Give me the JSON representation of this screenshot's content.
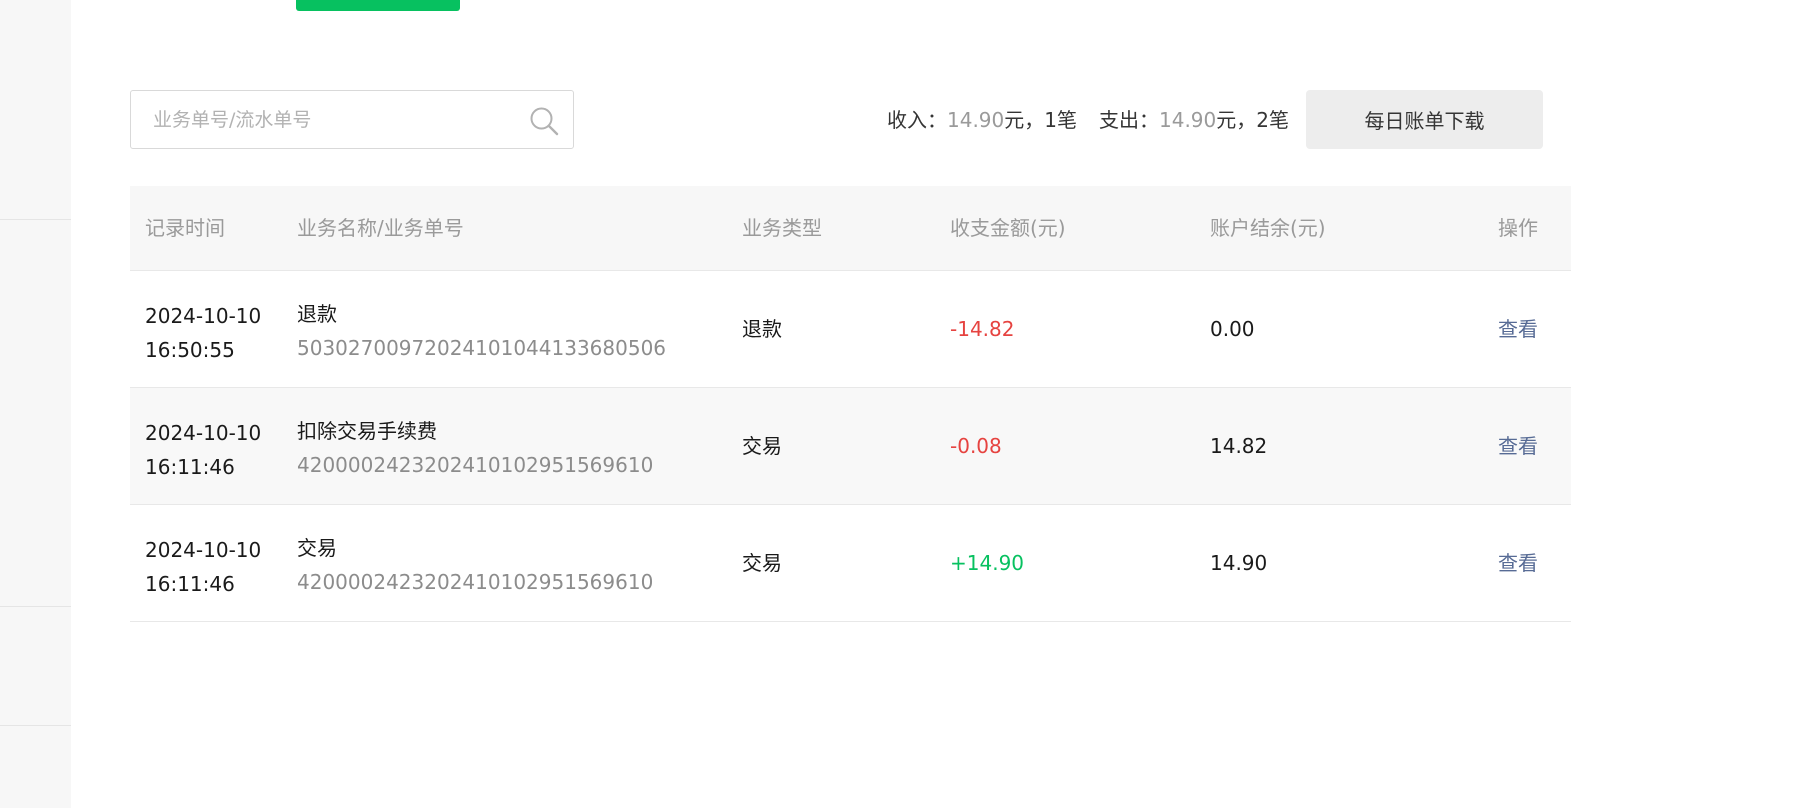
{
  "search": {
    "placeholder": "业务单号/流水单号",
    "value": ""
  },
  "summary": {
    "income_label": "收入：",
    "income_amount": "14.90",
    "income_unit": "元，",
    "income_count": "1笔",
    "expense_label": "支出：",
    "expense_amount": "14.90",
    "expense_unit": "元，",
    "expense_count": "2笔"
  },
  "download_button_label": "每日账单下载",
  "table": {
    "headers": {
      "time": "记录时间",
      "name": "业务名称/业务单号",
      "type": "业务类型",
      "amount": "收支金额(元)",
      "balance": "账户结余(元)",
      "action": "操作"
    },
    "rows": [
      {
        "date": "2024-10-10",
        "time": "16:50:55",
        "name": "退款",
        "number": "50302700972024101044133680506",
        "type": "退款",
        "amount": "-14.82",
        "amount_sign": "negative",
        "balance": "0.00",
        "action": "查看"
      },
      {
        "date": "2024-10-10",
        "time": "16:11:46",
        "name": "扣除交易手续费",
        "number": "4200002423202410102951569610",
        "type": "交易",
        "amount": "-0.08",
        "amount_sign": "negative",
        "balance": "14.82",
        "action": "查看"
      },
      {
        "date": "2024-10-10",
        "time": "16:11:46",
        "name": "交易",
        "number": "4200002423202410102951569610",
        "type": "交易",
        "amount": "+14.90",
        "amount_sign": "positive",
        "balance": "14.90",
        "action": "查看"
      }
    ]
  },
  "colors": {
    "accent_green": "#07c160",
    "negative_red": "#e64340",
    "link_blue": "#576b95"
  }
}
